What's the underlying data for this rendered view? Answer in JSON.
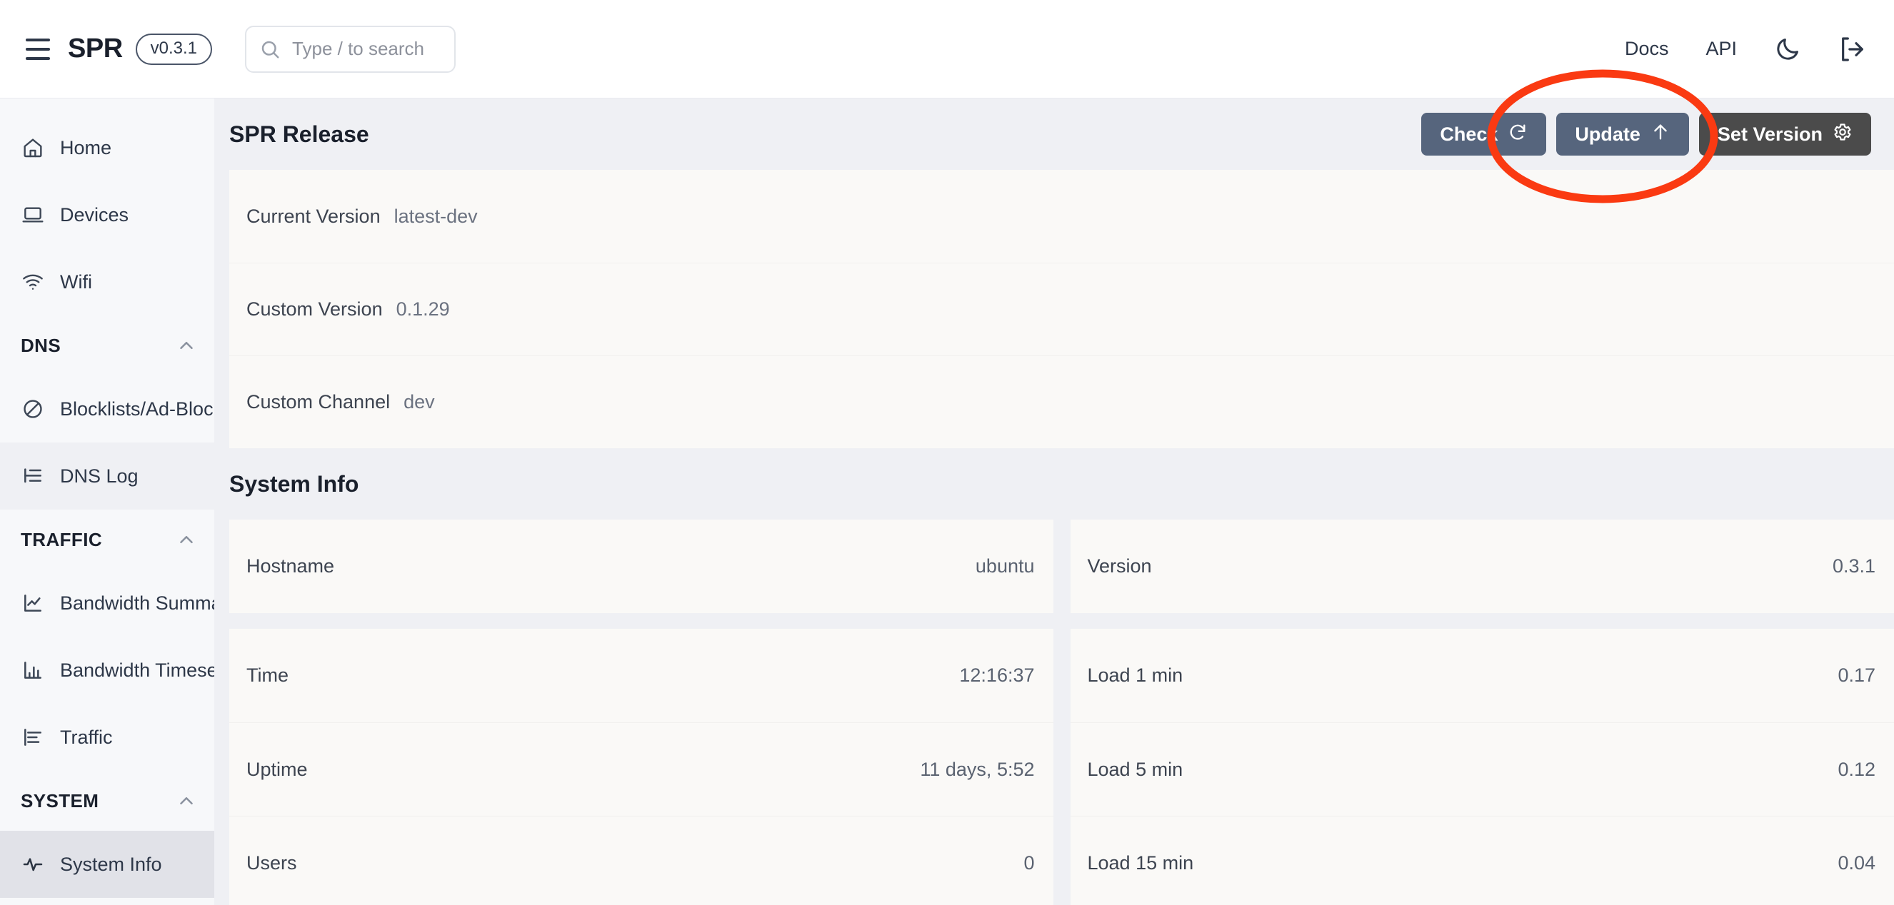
{
  "topbar": {
    "brand": "SPR",
    "version_pill": "v0.3.1",
    "search_placeholder": "Type / to search",
    "docs_label": "Docs",
    "api_label": "API",
    "theme_icon": "moon-icon",
    "logout_icon": "logout-icon"
  },
  "sidebar": {
    "items": [
      {
        "label": "Home",
        "icon": "home-icon"
      },
      {
        "label": "Devices",
        "icon": "laptop-icon"
      },
      {
        "label": "Wifi",
        "icon": "wifi-icon"
      }
    ],
    "groups": [
      {
        "label": "DNS",
        "collapse_icon": "chevron-up-icon",
        "items": [
          {
            "label": "Blocklists/Ad-Block",
            "icon": "ban-icon"
          },
          {
            "label": "DNS Log",
            "icon": "list-tree-icon"
          }
        ]
      },
      {
        "label": "TRAFFIC",
        "collapse_icon": "chevron-up-icon",
        "items": [
          {
            "label": "Bandwidth Summary",
            "icon": "line-chart-icon"
          },
          {
            "label": "Bandwidth Timeseries",
            "icon": "bar-chart-icon"
          },
          {
            "label": "Traffic",
            "icon": "horizontal-bar-chart-icon"
          }
        ]
      },
      {
        "label": "SYSTEM",
        "collapse_icon": "chevron-up-icon",
        "items": [
          {
            "label": "System Info",
            "icon": "activity-pulse-icon"
          }
        ]
      }
    ]
  },
  "release": {
    "title": "SPR Release",
    "buttons": {
      "check": {
        "label": "Check",
        "icon": "refresh-icon"
      },
      "update": {
        "label": "Update",
        "icon": "arrow-up-icon"
      },
      "set_version": {
        "label": "Set Version",
        "icon": "gear-icon"
      }
    },
    "rows": [
      {
        "label": "Current Version",
        "value": "latest-dev"
      },
      {
        "label": "Custom Version",
        "value": "0.1.29"
      },
      {
        "label": "Custom Channel",
        "value": "dev"
      }
    ]
  },
  "system_info": {
    "title": "System Info",
    "left_groups": [
      [
        {
          "label": "Hostname",
          "value": "ubuntu"
        }
      ],
      [
        {
          "label": "Time",
          "value": "12:16:37"
        },
        {
          "label": "Uptime",
          "value": "11 days, 5:52"
        },
        {
          "label": "Users",
          "value": "0"
        }
      ]
    ],
    "right_groups": [
      [
        {
          "label": "Version",
          "value": "0.3.1"
        }
      ],
      [
        {
          "label": "Load 1 min",
          "value": "0.17"
        },
        {
          "label": "Load 5 min",
          "value": "0.12"
        },
        {
          "label": "Load 15 min",
          "value": "0.04"
        }
      ]
    ]
  },
  "annotation": {
    "shape": "ellipse-highlight",
    "color": "#fa3a12",
    "targets": "update-button"
  }
}
